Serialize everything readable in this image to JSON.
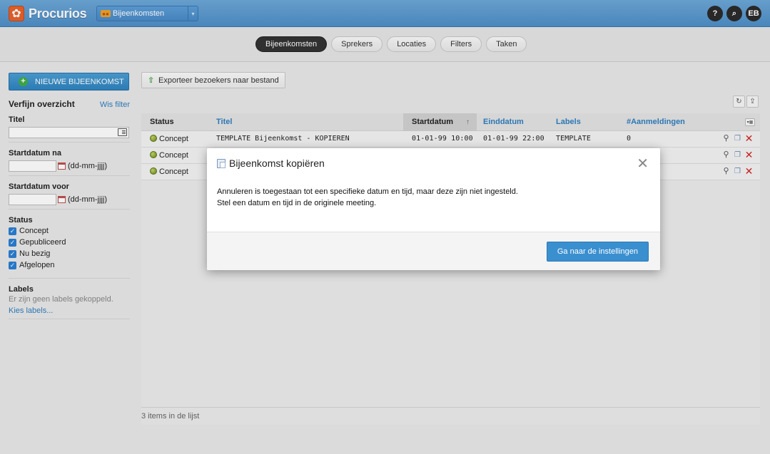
{
  "header": {
    "brand": "Procurios",
    "module": "Bijeenkomsten",
    "icons": [
      {
        "name": "help-icon",
        "glyph": "?"
      },
      {
        "name": "search-icon",
        "glyph": "⌕"
      },
      {
        "name": "user-avatar",
        "glyph": "EB"
      }
    ]
  },
  "tabs": [
    {
      "label": "Bijeenkomsten",
      "active": true
    },
    {
      "label": "Sprekers",
      "active": false
    },
    {
      "label": "Locaties",
      "active": false
    },
    {
      "label": "Filters",
      "active": false
    },
    {
      "label": "Taken",
      "active": false
    }
  ],
  "sidebar": {
    "new_button": "NIEUWE BIJEENKOMST",
    "refine_title": "Verfijn overzicht",
    "clear_filter": "Wis filter",
    "title_label": "Titel",
    "start_after_label": "Startdatum na",
    "start_before_label": "Startdatum voor",
    "date_hint": "(dd-mm-jjjj)",
    "status_label": "Status",
    "statuses": [
      "Concept",
      "Gepubliceerd",
      "Nu bezig",
      "Afgelopen"
    ],
    "labels_label": "Labels",
    "no_labels": "Er zijn geen labels gekoppeld.",
    "choose_labels": "Kies labels..."
  },
  "main": {
    "export_button": "Exporteer bezoekers naar bestand",
    "columns": [
      "Status",
      "Titel",
      "Startdatum",
      "Einddatum",
      "Labels",
      "#Aanmeldingen"
    ],
    "rows": [
      {
        "status": "Concept",
        "title": "TEMPLATE Bijeenkomst - KOPIEREN",
        "start": "01-01-99 10:00",
        "end": "01-01-99 22:00",
        "labels": "TEMPLATE",
        "count": "0"
      },
      {
        "status": "Concept",
        "title": "",
        "start": "",
        "end": "",
        "labels": "",
        "count": ""
      },
      {
        "status": "Concept",
        "title": "",
        "start": "",
        "end": "",
        "labels": "",
        "count": ""
      }
    ],
    "footer": "3 items in de lijst"
  },
  "modal": {
    "title": "Bijeenkomst kopiëren",
    "line1": "Annuleren is toegestaan tot een specifieke datum en tijd, maar deze zijn niet ingesteld.",
    "line2": "Stel een datum en tijd in de originele meeting.",
    "button": "Ga naar de instellingen"
  },
  "colors": {
    "topbar": "#4f8fc8",
    "primary": "#3a8fcf",
    "link": "#2f7fc0",
    "delete": "#d42222"
  }
}
